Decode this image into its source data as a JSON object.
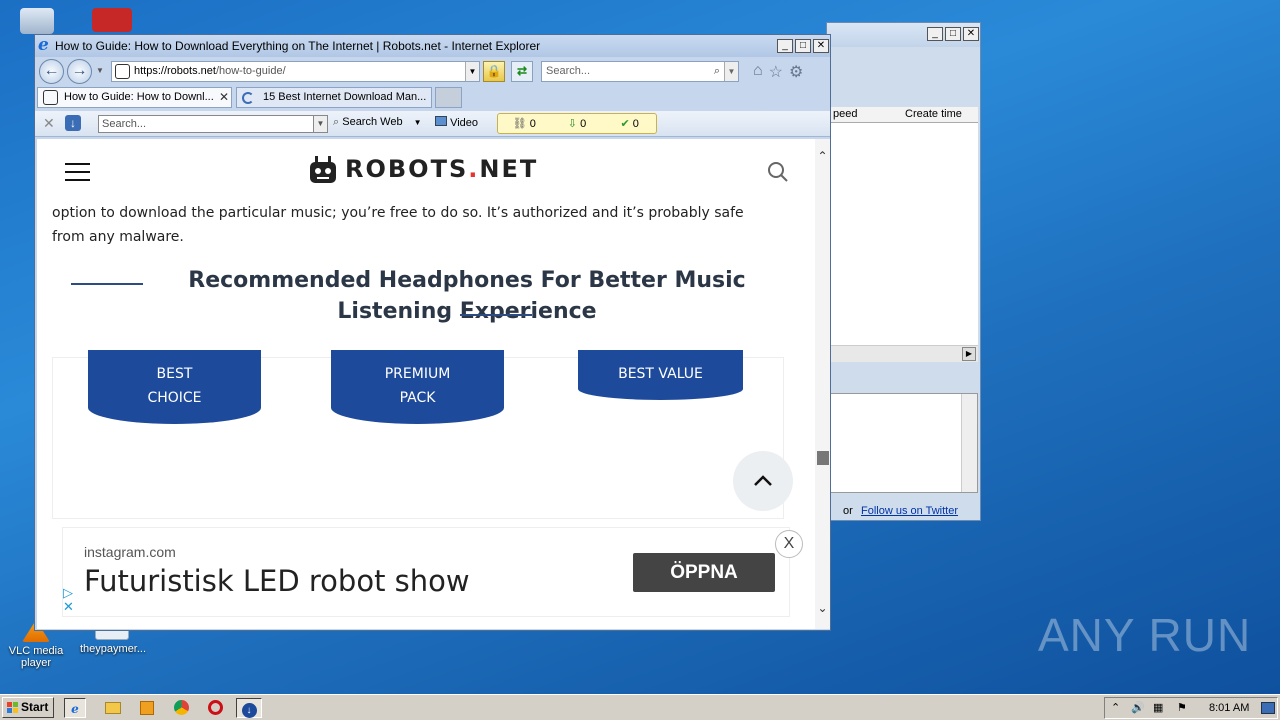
{
  "desktop": {
    "icons": [
      {
        "label": "VLC media player"
      },
      {
        "label": "theypaymer..."
      }
    ],
    "watermark": "ANY RUN"
  },
  "background_window": {
    "columns": [
      "peed",
      "Create time"
    ],
    "links": {
      "or": "or",
      "twitter": "Follow us on Twitter"
    }
  },
  "ie": {
    "title": "How to Guide: How to Download Everything on The Internet | Robots.net - Internet Explorer",
    "address": {
      "host": "https://robots.net",
      "path": "/how-to-guide/"
    },
    "search_placeholder": "Search...",
    "tabs": [
      {
        "label": "How to Guide: How to Downl..."
      },
      {
        "label": "15 Best Internet Download Man..."
      }
    ],
    "toolbar": {
      "search_placeholder": "Search...",
      "search_web": "Search Web",
      "video": "Video",
      "counters": [
        "0",
        "0",
        "0"
      ]
    }
  },
  "page": {
    "brand": {
      "prefix": "ROBOTS",
      "dot": ".",
      "suffix": "NET"
    },
    "paragraph": "option to download the particular music; you’re free to do so. It’s authorized and it’s probably safe from any malware.",
    "heading": "Recommended Headphones For Better Music Listening Experience",
    "badges": [
      {
        "line1": "BEST",
        "line2": "CHOICE"
      },
      {
        "line1": "PREMIUM",
        "line2": "PACK"
      },
      {
        "line1": "BEST VALUE",
        "line2": ""
      }
    ],
    "ad": {
      "domain": "instagram.com",
      "title": "Futuristisk LED robot show",
      "cta": "ÖPPNA",
      "close": "X"
    }
  },
  "taskbar": {
    "start": "Start",
    "clock": "8:01 AM"
  },
  "colors": {
    "accent": "#1d4a9b",
    "brand_dot": "#e8332a",
    "heading": "#2b3746"
  }
}
